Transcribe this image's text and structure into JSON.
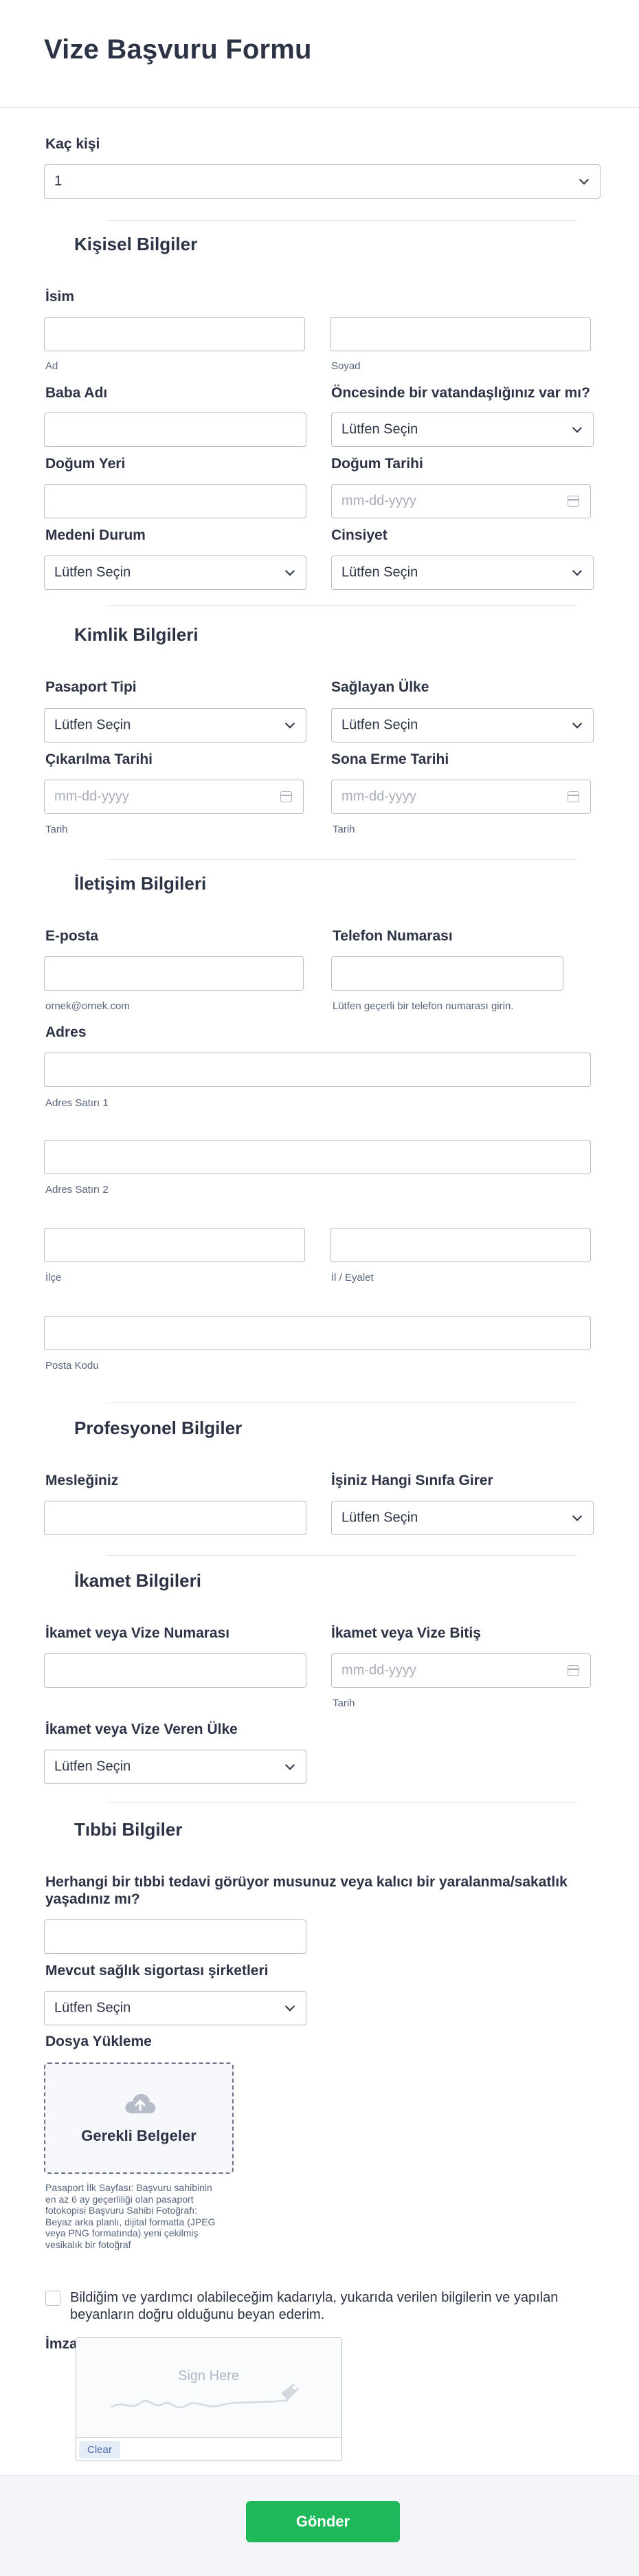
{
  "header": {
    "title": "Vize Başvuru Formu"
  },
  "persons": {
    "label": "Kaç kişi",
    "value": "1"
  },
  "personal": {
    "title": "Kişisel Bilgiler",
    "name_label": "İsim",
    "first_sub": "Ad",
    "last_sub": "Soyad",
    "father_label": "Baba Adı",
    "prev_citizen_label": "Öncesinde bir vatandaşlığınız var mı?",
    "prev_citizen_value": "Lütfen Seçin",
    "birthplace_label": "Doğum Yeri",
    "birthdate_label": "Doğum Tarihi",
    "birthdate_placeholder": "mm-dd-yyyy",
    "marital_label": "Medeni Durum",
    "marital_value": "Lütfen Seçin",
    "gender_label": "Cinsiyet",
    "gender_value": "Lütfen Seçin"
  },
  "identity": {
    "title": "Kimlik Bilgileri",
    "passport_type_label": "Pasaport Tipi",
    "passport_type_value": "Lütfen Seçin",
    "issuing_country_label": "Sağlayan Ülke",
    "issuing_country_value": "Lütfen Seçin",
    "issue_date_label": "Çıkarılma Tarihi",
    "issue_date_placeholder": "mm-dd-yyyy",
    "issue_date_sub": "Tarih",
    "expiry_label": "Sona Erme Tarihi",
    "expiry_placeholder": "mm-dd-yyyy",
    "expiry_sub": "Tarih"
  },
  "contact": {
    "title": "İletişim Bilgileri",
    "email_label": "E-posta",
    "email_sub": "ornek@ornek.com",
    "phone_label": "Telefon Numarası",
    "phone_sub": "Lütfen geçerli bir telefon numarası girin.",
    "address_label": "Adres",
    "addr1_sub": "Adres Satırı 1",
    "addr2_sub": "Adres Satırı 2",
    "district_sub": "İlçe",
    "state_sub": "İl / Eyalet",
    "zip_sub": "Posta Kodu"
  },
  "professional": {
    "title": "Profesyonel Bilgiler",
    "job_label": "Mesleğiniz",
    "class_label": "İşiniz Hangi Sınıfa Girer",
    "class_value": "Lütfen Seçin"
  },
  "residence": {
    "title": "İkamet Bilgileri",
    "number_label": "İkamet veya Vize Numarası",
    "end_label": "İkamet veya Vize Bitiş",
    "end_placeholder": "mm-dd-yyyy",
    "end_sub": "Tarih",
    "country_label": "İkamet veya Vize Veren Ülke",
    "country_value": "Lütfen Seçin"
  },
  "medical": {
    "title": "Tıbbi Bilgiler",
    "treatment_label_1": "Herhangi bir tıbbi tedavi görüyor musunuz veya kalıcı bir yaralanma/sakatlık",
    "treatment_label_2": "yaşadınız mı?",
    "insurance_label": "Mevcut sağlık sigortası şirketleri",
    "insurance_value": "Lütfen Seçin",
    "upload_label": "Dosya Yükleme",
    "upload_button": "Gerekli Belgeler",
    "upload_note_1": "Pasaport İlk Sayfası: Başvuru sahibinin",
    "upload_note_2": "en az 6 ay geçerliliği olan pasaport",
    "upload_note_3": "fotokopisi Başvuru Sahibi Fotoğrafı:",
    "upload_note_4": "Beyaz arka planlı, dijital formatta (JPEG",
    "upload_note_5": "veya PNG formatında) yeni çekilmiş",
    "upload_note_6": "vesikalık bir fotoğraf"
  },
  "declaration": {
    "line1": "Bildiğim ve yardımcı olabileceğim kadarıyla, yukarıda verilen bilgilerin ve yapılan",
    "line2": "beyanların doğru olduğunu beyan ederim."
  },
  "signature": {
    "label": "İmza",
    "placeholder": "Sign Here",
    "clear": "Clear"
  },
  "submit": {
    "label": "Gönder"
  }
}
